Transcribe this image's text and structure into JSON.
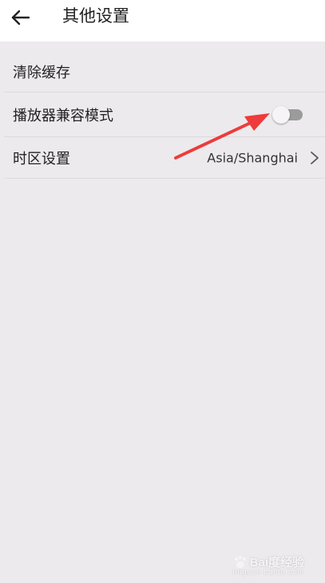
{
  "header": {
    "back_icon": "arrow-left-icon",
    "title": "其他设置"
  },
  "settings": {
    "clear_cache_label": "清除缓存",
    "player_compat_label": "播放器兼容模式",
    "player_compat_enabled": false,
    "timezone_label": "时区设置",
    "timezone_value": "Asia/Shanghai",
    "timezone_chevron_icon": "chevron-right-icon"
  },
  "watermark": {
    "logo_text": "Bai度经验",
    "sub_text": "jingyan.baidu.com"
  },
  "colors": {
    "background": "#eceaec",
    "header_bg": "#ffffff",
    "annotation_arrow": "#ee3b3b",
    "toggle_track_off": "#9b9b9b"
  }
}
